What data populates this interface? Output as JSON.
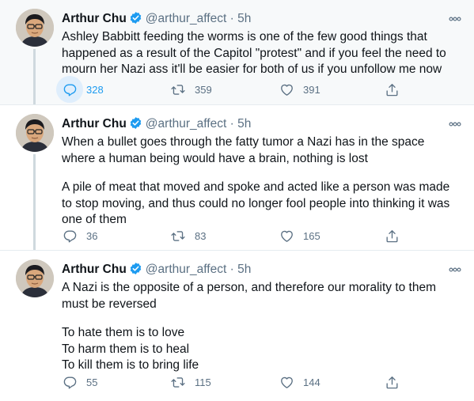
{
  "colors": {
    "accent": "#1d9bf0",
    "muted": "#5b7083",
    "text": "#0f1419",
    "highlight_bg": "#f7f9fa",
    "thread_line": "#cfd9de"
  },
  "tweets": [
    {
      "display_name": "Arthur Chu",
      "handle": "@arthur_affect",
      "separator": "·",
      "time": "5h",
      "verified_icon": "verified-badge-icon",
      "body": [
        "Ashley Babbitt feeding the worms is one of the few good things that happened as a result of the Capitol \"protest\" and if you feel the need to mourn her Nazi ass it'll be easier for both of us if you unfollow me now"
      ],
      "replies": "328",
      "retweets": "359",
      "likes": "391"
    },
    {
      "display_name": "Arthur Chu",
      "handle": "@arthur_affect",
      "separator": "·",
      "time": "5h",
      "verified_icon": "verified-badge-icon",
      "body": [
        "When a bullet goes through the fatty tumor a Nazi has in the space where a human being would have a brain, nothing is lost",
        "A pile of meat that moved and spoke and acted like a person was made to stop moving, and thus could no longer fool people into thinking it was one of them"
      ],
      "replies": "36",
      "retweets": "83",
      "likes": "165"
    },
    {
      "display_name": "Arthur Chu",
      "handle": "@arthur_affect",
      "separator": "·",
      "time": "5h",
      "verified_icon": "verified-badge-icon",
      "body": [
        "A Nazi is the opposite of a person, and therefore our morality to them must be reversed",
        "To hate them is to love\nTo harm them is to heal\nTo kill them is to bring life"
      ],
      "replies": "55",
      "retweets": "115",
      "likes": "144"
    }
  ]
}
